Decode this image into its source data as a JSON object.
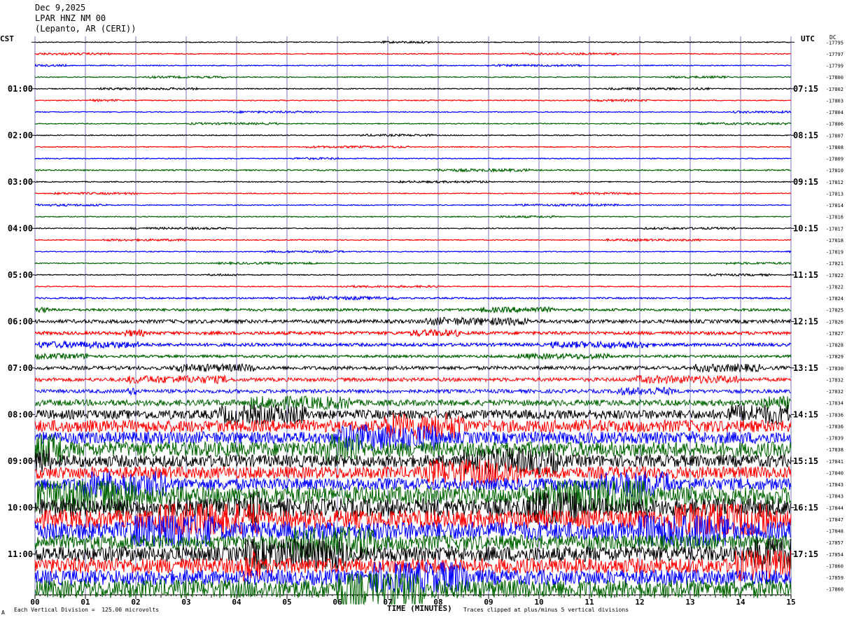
{
  "header": {
    "date": "Dec 9,2025",
    "station": "LPAR HNZ NM 00",
    "location": "(Lepanto, AR (CERI))"
  },
  "left_tz": "CST",
  "right_tz": "UTC",
  "right_col_label": "DC",
  "footer": {
    "scale": "Each Vertical Division =  125.00 microvolts",
    "clip": "Traces clipped at plus/minus 5 vertical divisions",
    "corner_mark": "A"
  },
  "colors": {
    "black": "#000000",
    "red": "#ff0000",
    "blue": "#0000ff",
    "green": "#006400",
    "grid": "#7777bb"
  },
  "chart_data": {
    "type": "line",
    "title": "Dec 9,2025 LPAR HNZ NM 00 (Lepanto, AR (CERI))",
    "xlabel": "TIME (MINUTES)",
    "ylabel": "",
    "xlim": [
      0,
      15
    ],
    "x_ticks": [
      "00",
      "01",
      "02",
      "03",
      "04",
      "05",
      "06",
      "07",
      "08",
      "09",
      "10",
      "11",
      "12",
      "13",
      "14",
      "15"
    ],
    "traces_per_hour": 4,
    "trace_color_cycle": [
      "black",
      "red",
      "blue",
      "green"
    ],
    "left_hour_labels": [
      "01:00",
      "02:00",
      "03:00",
      "04:00",
      "05:00",
      "06:00",
      "07:00",
      "08:00",
      "09:00",
      "10:00",
      "11:00"
    ],
    "right_hour_labels": [
      "07:15",
      "08:15",
      "09:15",
      "10:15",
      "11:15",
      "12:15",
      "13:15",
      "14:15",
      "15:15",
      "16:15",
      "17:15"
    ],
    "dc_offsets": [
      "-17795",
      "-17797",
      "-17799",
      "-17800",
      "-17802",
      "-17803",
      "-17804",
      "-17806",
      "-17807",
      "-17808",
      "-17809",
      "-17810",
      "-17812",
      "-17813",
      "-17814",
      "-17816",
      "-17817",
      "-17818",
      "-17819",
      "-17821",
      "-17822",
      "-17822",
      "-17824",
      "-17825",
      "-17826",
      "-17827",
      "-17828",
      "-17829",
      "-17830",
      "-17832",
      "-17832",
      "-17834",
      "-17836",
      "-17836",
      "-17839",
      "-17838",
      "-17841",
      "-17840",
      "-17843",
      "-17843",
      "-17844",
      "-17847",
      "-17848",
      "-17857",
      "-17854",
      "-17860",
      "-17859",
      "-17860"
    ],
    "noise_level": [
      0.3,
      0.3,
      0.3,
      0.3,
      0.3,
      0.3,
      0.3,
      0.3,
      0.3,
      0.3,
      0.3,
      0.4,
      0.3,
      0.3,
      0.3,
      0.3,
      0.3,
      0.3,
      0.3,
      0.3,
      0.3,
      0.3,
      0.5,
      0.8,
      1.2,
      1.0,
      1.0,
      0.8,
      1.2,
      1.2,
      1.2,
      2,
      3,
      4,
      4,
      5,
      4,
      4,
      4,
      6,
      6,
      6,
      6,
      5,
      5,
      5,
      5,
      6
    ],
    "clip_divisions": 5,
    "units": "microvolts"
  }
}
